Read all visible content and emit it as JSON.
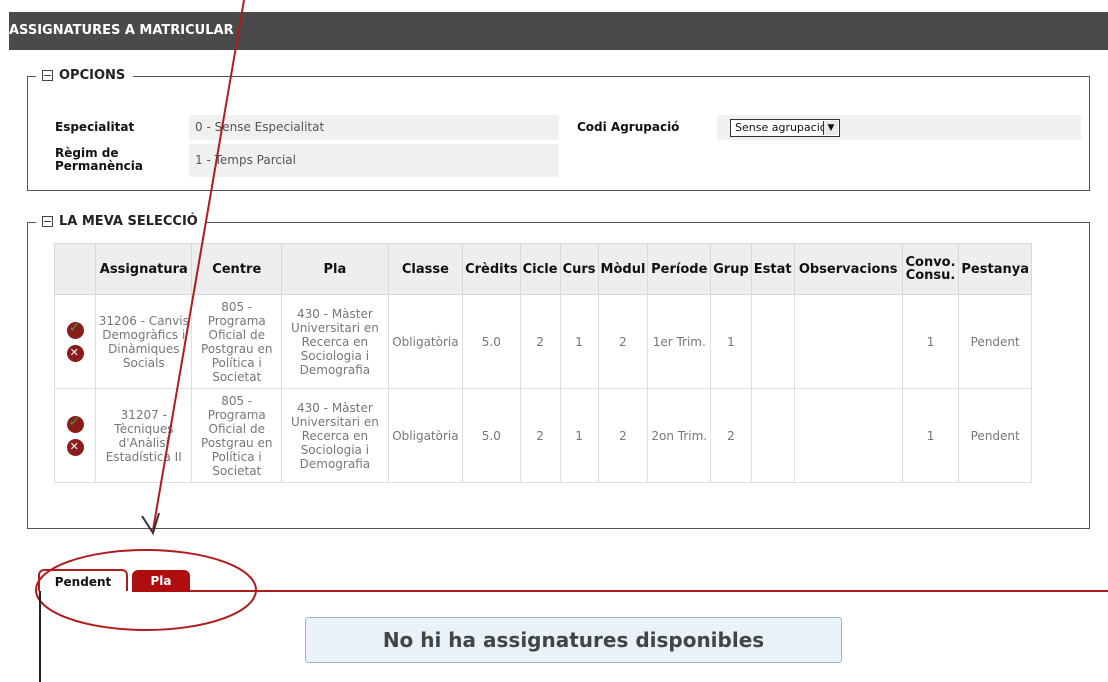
{
  "header": {
    "title": "ASSIGNATURES A MATRICULAR"
  },
  "opcions": {
    "legend": "OPCIONS",
    "especialitat_label": "Especialitat",
    "especialitat_value": "0 - Sense Especialitat",
    "regim_label_1": "Règim de",
    "regim_label_2": "Permanència",
    "regim_value": "1 - Temps Parcial",
    "codi_label": "Codi Agrupació",
    "codi_select": "Sense agrupació"
  },
  "seleccio": {
    "legend": "LA MEVA SELECCIÓ",
    "columns": [
      "",
      "Assignatura",
      "Centre",
      "Pla",
      "Classe",
      "Crèdits",
      "Cicle",
      "Curs",
      "Mòdul",
      "Període",
      "Grup",
      "Estat",
      "Observacions",
      "Convo. Consu.",
      "Pestanya"
    ],
    "rows": [
      {
        "assignatura": "31206 - Canvis Demogràfics i Dinàmiques Socials",
        "centre": "805 - Programa Oficial de Postgrau en Política i Societat",
        "pla": "430 - Màster Universitari en Recerca en Sociologia i Demografia",
        "classe": "Obligatòria",
        "credits": "5.0",
        "cicle": "2",
        "curs": "1",
        "modul": "2",
        "periode": "1er Trim.",
        "grup": "1",
        "estat": "",
        "observacions": "",
        "convo": "1",
        "pestanya": "Pendent"
      },
      {
        "assignatura": "31207 - Tècniques d'Anàlisi Estadística II",
        "centre": "805 - Programa Oficial de Postgrau en Política i Societat",
        "pla": "430 - Màster Universitari en Recerca en Sociologia i Demografia",
        "classe": "Obligatòria",
        "credits": "5.0",
        "cicle": "2",
        "curs": "1",
        "modul": "2",
        "periode": "2on Trim.",
        "grup": "2",
        "estat": "",
        "observacions": "",
        "convo": "1",
        "pestanya": "Pendent"
      }
    ]
  },
  "tabs": {
    "pendent": "Pendent",
    "pla": "Pla"
  },
  "empty_message": "No hi ha assignatures disponibles",
  "colors": {
    "header_bg": "#4a4a4a",
    "accent_red": "#b00e0e",
    "annotation": "#b01c1c"
  }
}
